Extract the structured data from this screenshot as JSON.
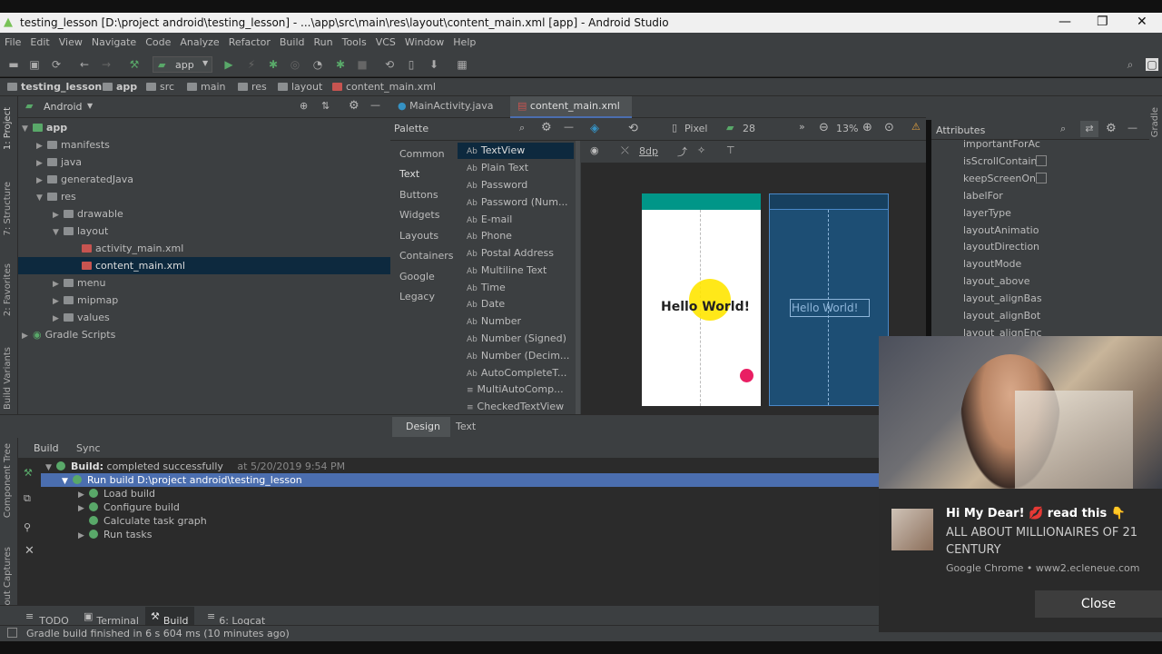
{
  "window": {
    "title": "testing_lesson [D:\\project android\\testing_lesson] - ...\\app\\src\\main\\res\\layout\\content_main.xml [app] - Android Studio"
  },
  "menu": [
    "File",
    "Edit",
    "View",
    "Navigate",
    "Code",
    "Analyze",
    "Refactor",
    "Build",
    "Run",
    "Tools",
    "VCS",
    "Window",
    "Help"
  ],
  "toolbar": {
    "run_config": "app"
  },
  "breadcrumb": [
    "testing_lesson",
    "app",
    "src",
    "main",
    "res",
    "layout",
    "content_main.xml"
  ],
  "side_tabs": {
    "left": [
      "1: Project",
      "7: Structure",
      "2: Favorites",
      "Build Variants",
      "Component Tree",
      "Layout Captures"
    ],
    "right": [
      "Gradle"
    ]
  },
  "project": {
    "view_mode": "Android",
    "tree": [
      "app",
      "manifests",
      "java",
      "generatedJava",
      "res",
      "drawable",
      "layout",
      "activity_main.xml",
      "content_main.xml",
      "menu",
      "mipmap",
      "values",
      "Gradle Scripts"
    ]
  },
  "editor_tabs": [
    "MainActivity.java",
    "content_main.xml"
  ],
  "palette": {
    "title": "Palette",
    "categories": [
      "Common",
      "Text",
      "Buttons",
      "Widgets",
      "Layouts",
      "Containers",
      "Google",
      "Legacy"
    ],
    "selected_category": "Text",
    "items": [
      "TextView",
      "Plain Text",
      "Password",
      "Password (Num...",
      "E-mail",
      "Phone",
      "Postal Address",
      "Multiline Text",
      "Time",
      "Date",
      "Number",
      "Number (Signed)",
      "Number (Decim...",
      "AutoCompleteT...",
      "MultiAutoComp...",
      "CheckedTextView"
    ],
    "item_icons": [
      "Ab",
      "Ab",
      "Ab",
      "Ab",
      "Ab",
      "Ab",
      "Ab",
      "Ab",
      "Ab",
      "Ab",
      "Ab",
      "Ab",
      "Ab",
      "Ab",
      "≡",
      "≡"
    ]
  },
  "design_toolbar": {
    "device": "Pixel",
    "api": "28",
    "zoom": "13%",
    "margin": "8dp"
  },
  "preview": {
    "text": "Hello World!",
    "blueprint_text": "Hello World!"
  },
  "editor_mode_tabs": [
    "Design",
    "Text"
  ],
  "attributes": {
    "title": "Attributes",
    "items": [
      "importantForAc",
      "isScrollContain",
      "keepScreenOn",
      "labelFor",
      "layerType",
      "layoutAnimatio",
      "layoutDirection",
      "layoutMode",
      "layout_above",
      "layout_alignBas",
      "layout_alignBot",
      "layout_alignEnc"
    ]
  },
  "build_panel": {
    "tabs": [
      "Build",
      "Sync"
    ],
    "rows": [
      {
        "label": "Build:",
        "text": "completed successfully",
        "time": "at 5/20/2019 9:54 PM"
      },
      {
        "label": "Run build",
        "text": "D:\\project android\\testing_lesson"
      },
      {
        "text": "Load build"
      },
      {
        "text": "Configure build"
      },
      {
        "text": "Calculate task graph"
      },
      {
        "text": "Run tasks"
      }
    ]
  },
  "tool_tabs": [
    "TODO",
    "Terminal",
    "Build",
    "6: Logcat"
  ],
  "tool_tab_icons": [
    "≡",
    "▣",
    "⚒",
    "≡"
  ],
  "status": {
    "text": "Gradle build finished in 6 s 604 ms (10 minutes ago)"
  },
  "ad": {
    "title": "Hi My Dear! 💋 read this 👇",
    "body": "ALL ABOUT MILLIONAIRES OF 21 CENTURY",
    "source": "Google Chrome • www2.ecleneue.com",
    "close": "Close"
  },
  "colors": {
    "accent": "#4b6eaf",
    "selection": "#0d293e",
    "teal": "#009688",
    "green": "#59a869"
  }
}
